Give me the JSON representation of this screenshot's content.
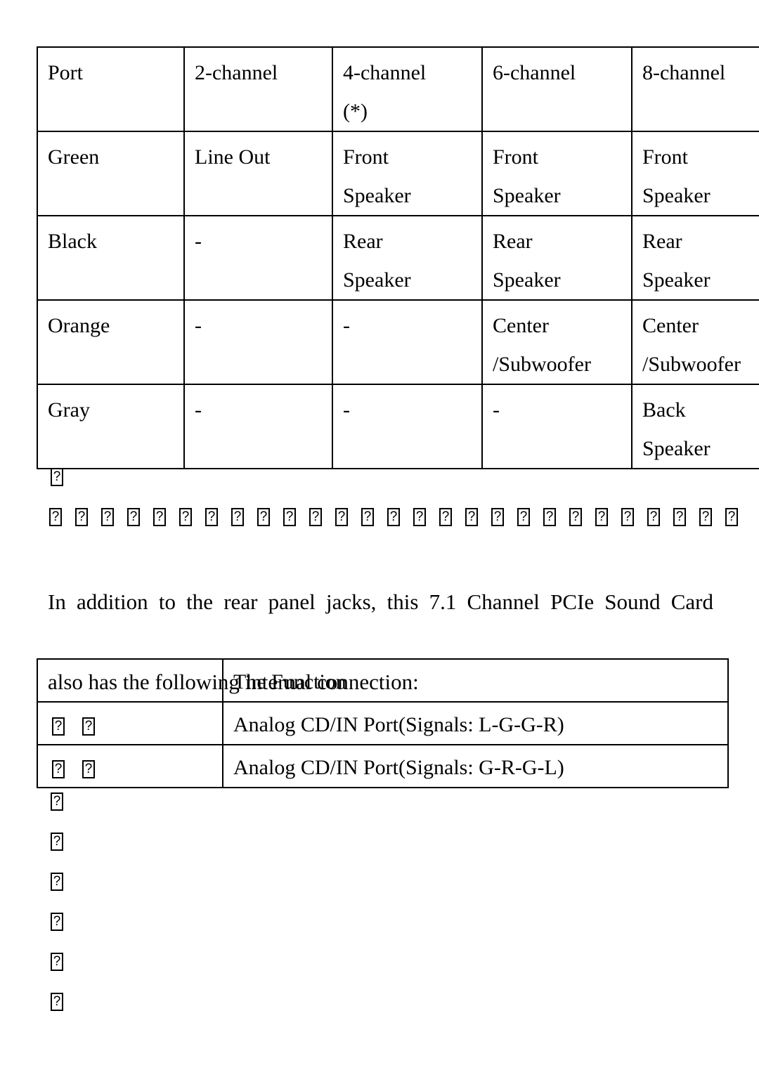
{
  "document": {
    "tables": [
      {
        "name": "audio-port-channel-mapping",
        "header": [
          {
            "lines": [
              "Port"
            ]
          },
          {
            "lines": [
              "2-channel"
            ]
          },
          {
            "lines": [
              "4-channel",
              "(*)"
            ]
          },
          {
            "lines": [
              "6-channel"
            ]
          },
          {
            "lines": [
              "8-channel"
            ]
          }
        ],
        "rows": [
          {
            "cells": [
              {
                "lines": [
                  "Green"
                ]
              },
              {
                "lines": [
                  "Line Out"
                ]
              },
              {
                "lines": [
                  "Front",
                  "Speaker"
                ]
              },
              {
                "lines": [
                  "Front",
                  "Speaker"
                ]
              },
              {
                "lines": [
                  "Front",
                  "Speaker"
                ]
              }
            ]
          },
          {
            "cells": [
              {
                "lines": [
                  "Black"
                ]
              },
              {
                "lines": [
                  "-"
                ]
              },
              {
                "lines": [
                  "Rear",
                  "Speaker"
                ]
              },
              {
                "lines": [
                  "Rear",
                  "Speaker"
                ]
              },
              {
                "lines": [
                  "Rear",
                  "Speaker"
                ]
              }
            ]
          },
          {
            "cells": [
              {
                "lines": [
                  "Orange"
                ]
              },
              {
                "lines": [
                  "-"
                ]
              },
              {
                "lines": [
                  "-"
                ]
              },
              {
                "lines": [
                  "Center",
                  "/Subwoofer"
                ]
              },
              {
                "lines": [
                  "Center",
                  "/Subwoofer"
                ]
              }
            ]
          },
          {
            "cells": [
              {
                "lines": [
                  "Gray"
                ]
              },
              {
                "lines": [
                  "-"
                ]
              },
              {
                "lines": [
                  "-"
                ]
              },
              {
                "lines": [
                  "-"
                ]
              },
              {
                "lines": [
                  "Back",
                  "Speaker"
                ]
              }
            ]
          }
        ]
      },
      {
        "name": "internal-connection",
        "header": [
          "",
          "The Function"
        ],
        "rows": [
          {
            "label_missing_glyphs": 2,
            "function": "Analog CD/IN Port(Signals: L-G-G-R)"
          },
          {
            "label_missing_glyphs": 2,
            "function": "Analog CD/IN Port(Signals: G-R-G-L)"
          }
        ]
      }
    ],
    "paragraph": {
      "line1": "In addition to the rear panel jacks, this 7.1 Channel PCIe Sound Card",
      "line2": "also has the following internal connection:"
    },
    "missing_glyph": {
      "symbol": "?",
      "note": "tofu box shown for unrenderable character",
      "single_after_table": 1,
      "long_row_count": 27,
      "trailing_single_count": 6
    },
    "colors": {
      "text": "#000000",
      "background": "#ffffff",
      "border": "#000000"
    }
  }
}
